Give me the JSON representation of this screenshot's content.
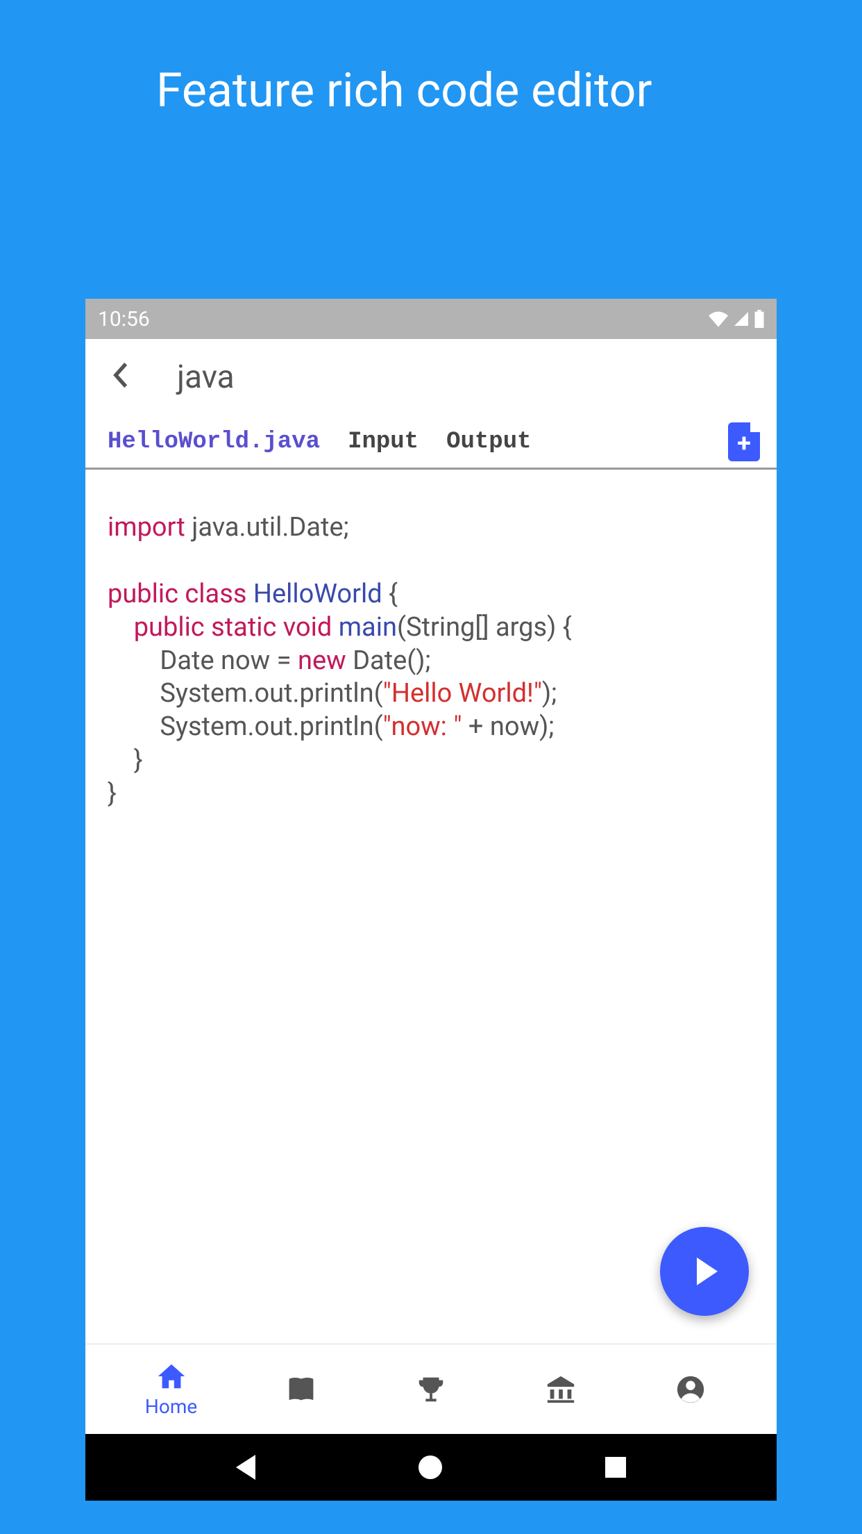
{
  "headline": "Feature rich code editor",
  "status": {
    "time": "10:56"
  },
  "appbar": {
    "title": "java"
  },
  "tabs": {
    "active": "HelloWorld.java",
    "input": "Input",
    "output": "Output"
  },
  "code": {
    "line1_kw": "import",
    "line1_rest": " java.util.Date;",
    "line3_kw": "public class",
    "line3_class": " HelloWorld",
    "line3_rest": " {",
    "line4_indent": "    ",
    "line4_kw": "public static void",
    "line4_main": " main",
    "line4_rest": "(String[] args) {",
    "line5": "        Date now = ",
    "line5_new": "new",
    "line5_rest": " Date();",
    "line6a": "        System.out.println(",
    "line6_str": "\"Hello World!\"",
    "line6b": ");",
    "line7a": "        System.out.println(",
    "line7_str": "\"now: \"",
    "line7b": " + now);",
    "line8": "    }",
    "line9": "}"
  },
  "bottomnav": {
    "home": "Home"
  }
}
